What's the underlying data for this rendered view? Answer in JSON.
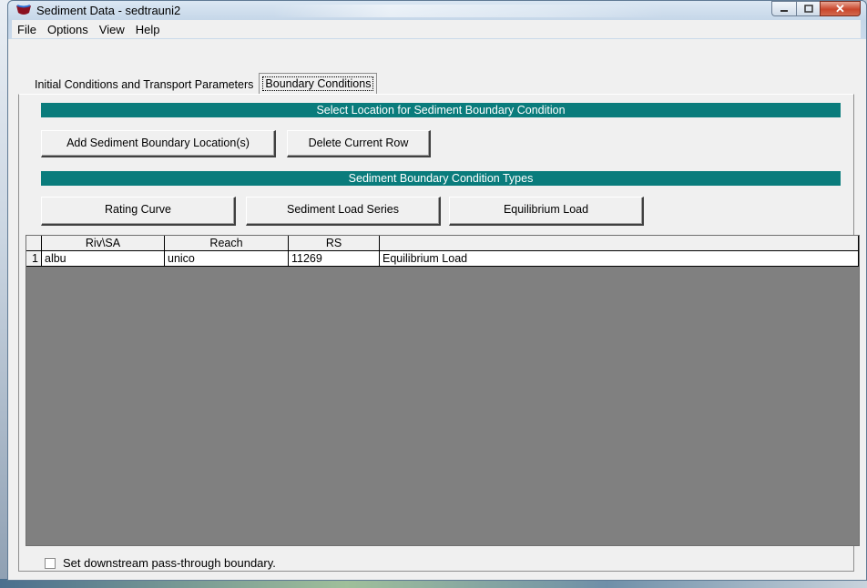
{
  "window": {
    "title": "Sediment Data - sedtrauni2"
  },
  "menu": [
    "File",
    "Options",
    "View",
    "Help"
  ],
  "tabs": [
    {
      "label": "Initial Conditions and Transport Parameters"
    },
    {
      "label": "Boundary Conditions"
    }
  ],
  "location_section": {
    "header": "Select Location for Sediment Boundary Condition",
    "add_button": "Add Sediment Boundary Location(s)",
    "delete_button": "Delete Current Row"
  },
  "types_section": {
    "header": "Sediment Boundary Condition Types",
    "rating_curve_button": "Rating Curve",
    "load_series_button": "Sediment Load Series",
    "equilibrium_button": "Equilibrium Load"
  },
  "table": {
    "columns": [
      "",
      "Riv\\SA",
      "Reach",
      "RS",
      ""
    ],
    "rows": [
      [
        "1",
        "albu",
        "unico",
        "11269",
        "Equilibrium Load"
      ]
    ]
  },
  "checkbox": {
    "label": "Set downstream pass-through boundary.",
    "checked": false
  }
}
